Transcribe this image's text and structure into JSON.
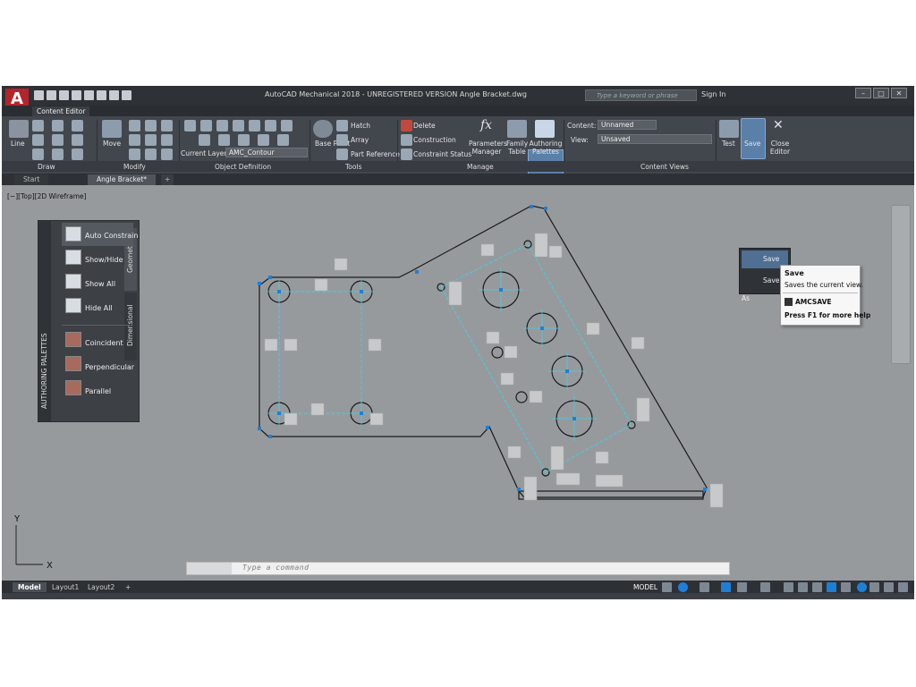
{
  "window": {
    "title": "AutoCAD Mechanical 2018 - UNREGISTERED VERSION    Angle Bracket.dwg",
    "app_icon_letter": "A",
    "search_placeholder": "Type a keyword or phrase",
    "sign_in": "Sign In",
    "min": "–",
    "max": "□",
    "close": "✕"
  },
  "ribbon_tab": "Content Editor",
  "ribbon": {
    "draw": {
      "line": "Line",
      "panel": "Draw"
    },
    "modify": {
      "move": "Move",
      "panel": "Modify"
    },
    "object_definition": {
      "current_layer_label": "Current Layer:",
      "current_layer_value": "AMC_Contour",
      "panel": "Object Definition"
    },
    "tools": {
      "base_point": "Base Point",
      "hatch": "Hatch",
      "array": "Array",
      "part_reference": "Part Reference",
      "panel": "Tools"
    },
    "manage": {
      "delete": "Delete",
      "construction": "Construction",
      "constraint_status": "Constraint Status",
      "parameters_manager": "Parameters Manager",
      "family_table": "Family Table",
      "authoring_palettes": "Authoring Palettes",
      "panel": "Manage",
      "fx_symbol": "fx"
    },
    "content_views": {
      "content_label": "Content:",
      "content_value": "Unnamed",
      "view_label": "View:",
      "view_value": "Unsaved",
      "panel": "Content Views"
    },
    "test": "Test",
    "save": "Save",
    "close_editor": "Close Editor"
  },
  "save_menu": {
    "item1": "Save",
    "item2": "Save As"
  },
  "tooltip": {
    "title": "Save",
    "desc": "Saves the current view.",
    "command": "AMCSAVE",
    "help": "Press F1 for more help"
  },
  "doc_tabs": {
    "start": "Start",
    "active": "Angle Bracket*",
    "add": "+"
  },
  "viewport_label": "[−][Top][2D Wireframe]",
  "palette": {
    "title": "AUTHORING PALETTES",
    "tab_geometric": "Geometric",
    "tab_dimensional": "Dimensional",
    "items": [
      {
        "label": "Auto Constrain"
      },
      {
        "label": "Show/Hide"
      },
      {
        "label": "Show All"
      },
      {
        "label": "Hide All"
      },
      {
        "label": "Coincident"
      },
      {
        "label": "Perpendicular"
      },
      {
        "label": "Parallel"
      }
    ]
  },
  "ucs": {
    "x": "X",
    "y": "Y"
  },
  "command": {
    "placeholder": "Type a command"
  },
  "layouts": {
    "model": "Model",
    "layout1": "Layout1",
    "layout2": "Layout2",
    "add": "+"
  },
  "status": {
    "model": "MODEL"
  },
  "colors": {
    "accent": "#1e7fd6",
    "geometry": "#1a1a1a",
    "construction": "#3fd0e8",
    "canvas": "#979a9d"
  }
}
